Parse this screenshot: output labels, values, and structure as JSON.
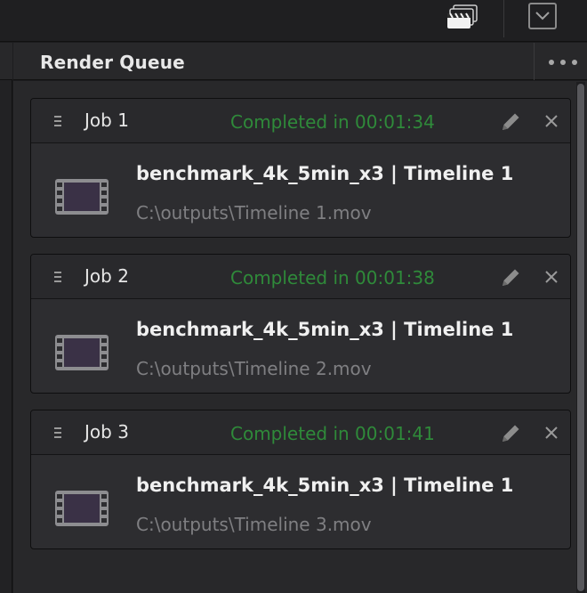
{
  "header": {
    "title": "Render Queue",
    "icons": [
      "clapperboard-icon",
      "dropdown-toggle-icon",
      "more-options-icon"
    ]
  },
  "colors": {
    "status_completed": "#2f8a3a",
    "path_text": "#7f7f82",
    "panel_bg": "#28282a"
  },
  "jobs": [
    {
      "label": "Job 1",
      "status": "Completed in 00:01:34",
      "name": "benchmark_4k_5min_x3 | Timeline 1",
      "path": "C:\\outputs\\Timeline 1.mov"
    },
    {
      "label": "Job 2",
      "status": "Completed in 00:01:38",
      "name": "benchmark_4k_5min_x3 | Timeline 1",
      "path": "C:\\outputs\\Timeline 2.mov"
    },
    {
      "label": "Job 3",
      "status": "Completed in 00:01:41",
      "name": "benchmark_4k_5min_x3 | Timeline 1",
      "path": "C:\\outputs\\Timeline 3.mov"
    }
  ]
}
